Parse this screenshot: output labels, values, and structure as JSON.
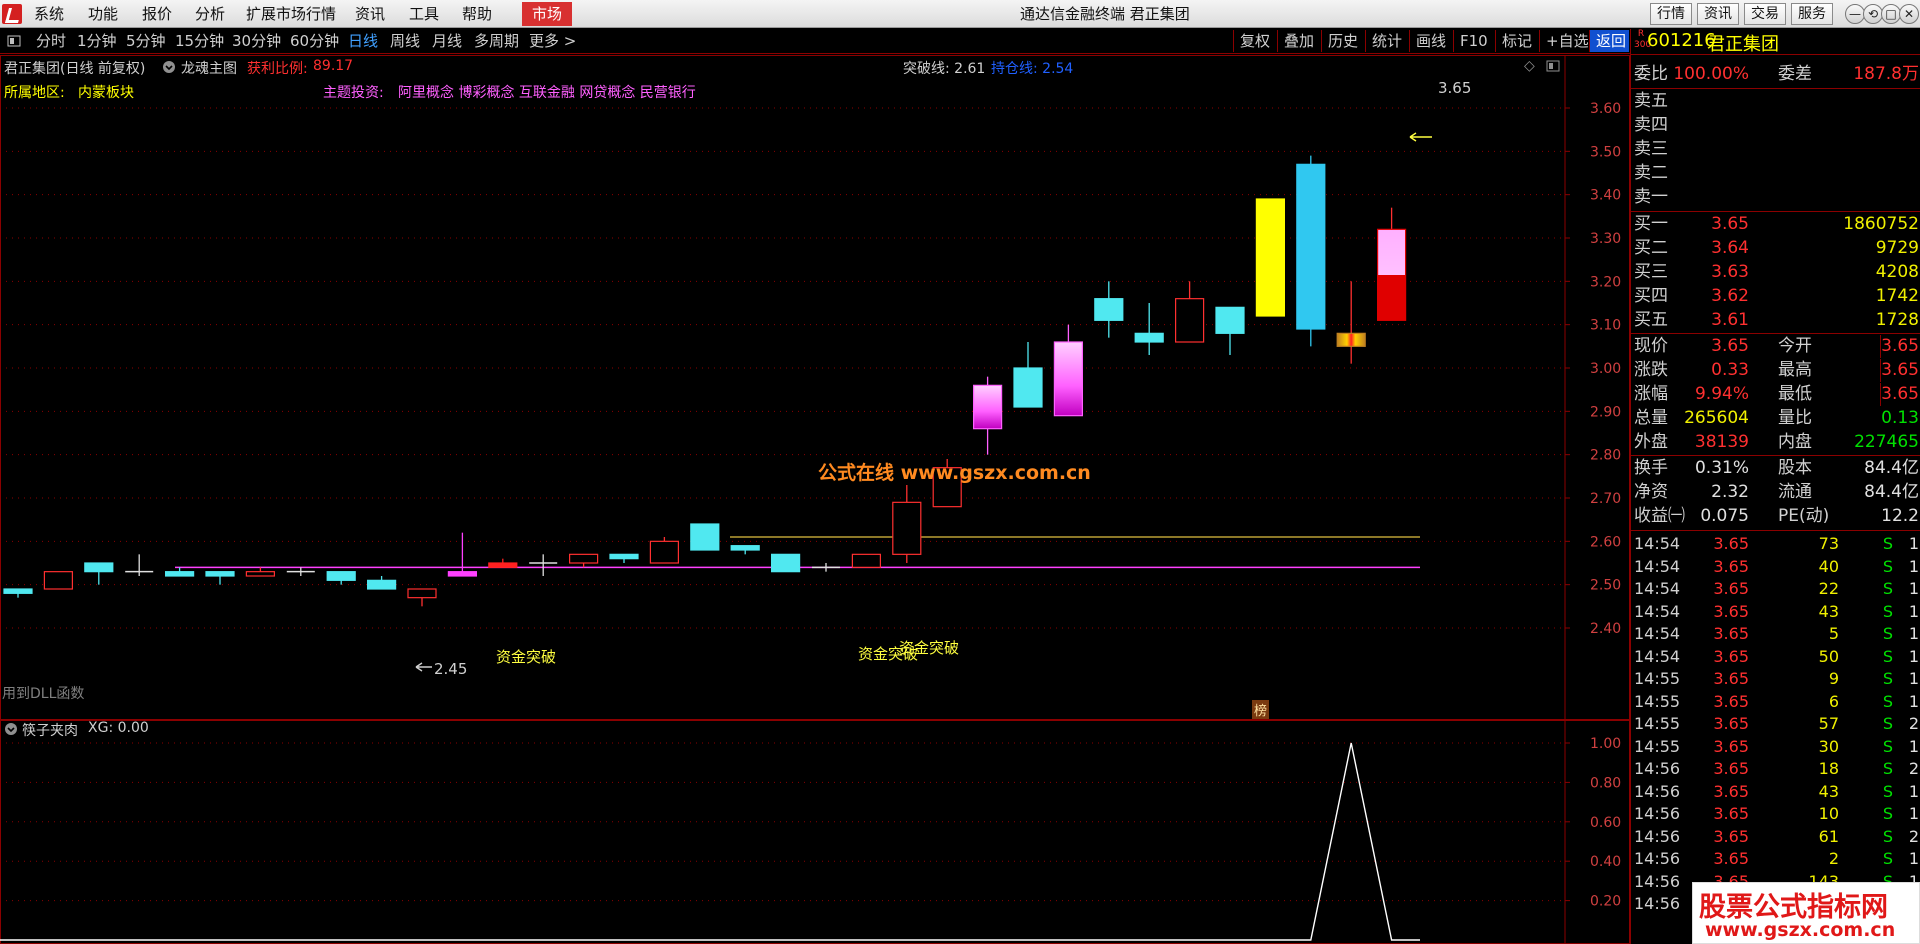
{
  "menubar": {
    "items": [
      "系统",
      "功能",
      "报价",
      "分析",
      "扩展市场行情",
      "资讯",
      "工具",
      "帮助"
    ],
    "market_tab": "市场",
    "app_title": "通达信金融终端  君正集团",
    "right_buttons": [
      "行情",
      "资讯",
      "交易",
      "服务"
    ],
    "window_buttons": [
      "—",
      "⟲",
      "□",
      "✕"
    ]
  },
  "toolbar": {
    "periods": [
      "分时",
      "1分钟",
      "5分钟",
      "15分钟",
      "30分钟",
      "60分钟",
      "日线",
      "周线",
      "月线",
      "多周期",
      "更多 >"
    ],
    "active_period": "日线",
    "right_tools": [
      "复权",
      "叠加",
      "历史",
      "统计",
      "画线",
      "F10",
      "标记",
      "+自选",
      "返回"
    ],
    "active_tool": "返回"
  },
  "main_chart": {
    "header_name": "君正集团(日线 前复权)",
    "indicator_name": "龙魂主图",
    "profit_label": "获利比例:",
    "profit_value": "89.17",
    "breakout_label": "突破线: 2.61",
    "position_label": "持仓线: 2.54",
    "region_label": "所属地区:",
    "region_value": "内蒙板块",
    "theme_label": "主题投资:",
    "theme_value": "阿里概念 博彩概念 互联金融 网贷概念 民营银行",
    "dll_note": "用到DLL函数",
    "watermark_center": "公式在线   www.gszx.com.cn",
    "bang_label": "榜",
    "high_marker": "3.65",
    "low_marker": "2.45",
    "signal_labels": [
      "资金突破",
      "资金突破",
      "资金突破"
    ]
  },
  "chart_data": [
    {
      "type": "candlestick",
      "title": "君正集团(日线 前复权)",
      "ylim": [
        2.34,
        3.66
      ],
      "y_ticks": [
        "3.60",
        "3.50",
        "3.40",
        "3.30",
        "3.20",
        "3.10",
        "3.00",
        "2.90",
        "2.80",
        "2.70",
        "2.60",
        "2.50",
        "2.40"
      ],
      "breakout_line": 2.61,
      "position_line": 2.54,
      "candles": [
        {
          "o": 2.48,
          "c": 2.49,
          "h": 2.49,
          "l": 2.47,
          "color": "#50e8f0",
          "fill": "solid"
        },
        {
          "o": 2.49,
          "c": 2.53,
          "h": 2.53,
          "l": 2.49,
          "color": "#ff3030",
          "fill": "hollow"
        },
        {
          "o": 2.55,
          "c": 2.53,
          "h": 2.55,
          "l": 2.5,
          "color": "#50e8f0",
          "fill": "solid"
        },
        {
          "o": 2.53,
          "c": 2.53,
          "h": 2.57,
          "l": 2.52,
          "color": "#e0e0e0",
          "fill": "doji"
        },
        {
          "o": 2.53,
          "c": 2.52,
          "h": 2.54,
          "l": 2.52,
          "color": "#50e8f0",
          "fill": "solid"
        },
        {
          "o": 2.53,
          "c": 2.52,
          "h": 2.53,
          "l": 2.5,
          "color": "#50e8f0",
          "fill": "solid"
        },
        {
          "o": 2.52,
          "c": 2.53,
          "h": 2.54,
          "l": 2.52,
          "color": "#ff3030",
          "fill": "hollow"
        },
        {
          "o": 2.53,
          "c": 2.53,
          "h": 2.54,
          "l": 2.52,
          "color": "#e0e0e0",
          "fill": "doji"
        },
        {
          "o": 2.53,
          "c": 2.51,
          "h": 2.53,
          "l": 2.5,
          "color": "#50e8f0",
          "fill": "solid"
        },
        {
          "o": 2.51,
          "c": 2.49,
          "h": 2.52,
          "l": 2.49,
          "color": "#50e8f0",
          "fill": "solid"
        },
        {
          "o": 2.47,
          "c": 2.49,
          "h": 2.49,
          "l": 2.45,
          "color": "#ff3030",
          "fill": "hollow"
        },
        {
          "o": 2.53,
          "c": 2.52,
          "h": 2.62,
          "l": 2.52,
          "color": "#ff40ff",
          "fill": "solid"
        },
        {
          "o": 2.54,
          "c": 2.55,
          "h": 2.56,
          "l": 2.54,
          "color": "#ff2020",
          "fill": "solid"
        },
        {
          "o": 2.55,
          "c": 2.55,
          "h": 2.57,
          "l": 2.52,
          "color": "#e0e0e0",
          "fill": "doji"
        },
        {
          "o": 2.55,
          "c": 2.57,
          "h": 2.57,
          "l": 2.54,
          "color": "#ff3030",
          "fill": "hollow"
        },
        {
          "o": 2.57,
          "c": 2.56,
          "h": 2.57,
          "l": 2.55,
          "color": "#50e8f0",
          "fill": "solid"
        },
        {
          "o": 2.55,
          "c": 2.6,
          "h": 2.61,
          "l": 2.55,
          "color": "#ff3030",
          "fill": "hollow"
        },
        {
          "o": 2.64,
          "c": 2.58,
          "h": 2.64,
          "l": 2.58,
          "color": "#50e8f0",
          "fill": "solid"
        },
        {
          "o": 2.59,
          "c": 2.58,
          "h": 2.59,
          "l": 2.57,
          "color": "#50e8f0",
          "fill": "solid"
        },
        {
          "o": 2.57,
          "c": 2.53,
          "h": 2.57,
          "l": 2.53,
          "color": "#50e8f0",
          "fill": "solid"
        },
        {
          "o": 2.54,
          "c": 2.54,
          "h": 2.55,
          "l": 2.53,
          "color": "#e0e0e0",
          "fill": "doji"
        },
        {
          "o": 2.54,
          "c": 2.57,
          "h": 2.57,
          "l": 2.54,
          "color": "#ff3030",
          "fill": "hollow"
        },
        {
          "o": 2.57,
          "c": 2.69,
          "h": 2.73,
          "l": 2.55,
          "color": "#ff3030",
          "fill": "hollow"
        },
        {
          "o": 2.68,
          "c": 2.77,
          "h": 2.79,
          "l": 2.68,
          "color": "#ff3030",
          "fill": "hollow"
        },
        {
          "o": 2.86,
          "c": 2.96,
          "h": 2.98,
          "l": 2.8,
          "color": "#ff60ff",
          "fill": "gradient"
        },
        {
          "o": 3.0,
          "c": 2.91,
          "h": 3.06,
          "l": 2.91,
          "color": "#50e8f0",
          "fill": "solid"
        },
        {
          "o": 2.89,
          "c": 3.06,
          "h": 3.1,
          "l": 2.89,
          "color": "#ff60ff",
          "fill": "gradient"
        },
        {
          "o": 3.16,
          "c": 3.11,
          "h": 3.2,
          "l": 3.07,
          "color": "#50e8f0",
          "fill": "solid"
        },
        {
          "o": 3.08,
          "c": 3.06,
          "h": 3.15,
          "l": 3.03,
          "color": "#50e8f0",
          "fill": "solid"
        },
        {
          "o": 3.06,
          "c": 3.16,
          "h": 3.2,
          "l": 3.06,
          "color": "#ff3030",
          "fill": "hollow"
        },
        {
          "o": 3.14,
          "c": 3.08,
          "h": 3.14,
          "l": 3.03,
          "color": "#50e8f0",
          "fill": "solid"
        },
        {
          "o": 3.12,
          "c": 3.39,
          "h": 3.39,
          "l": 3.12,
          "color": "#ffff00",
          "fill": "solid"
        },
        {
          "o": 3.47,
          "c": 3.09,
          "h": 3.49,
          "l": 3.05,
          "color": "#30c8f0",
          "fill": "solid"
        },
        {
          "o": 3.08,
          "c": 3.05,
          "h": 3.2,
          "l": 3.01,
          "color": "#e0c020",
          "fill": "mixed"
        },
        {
          "o": 3.11,
          "c": 3.32,
          "h": 3.37,
          "l": 3.11,
          "color": "#ff2020",
          "fill": "gradient2"
        }
      ]
    },
    {
      "type": "line",
      "title": "筷子夹肉",
      "series": [
        {
          "name": "XG",
          "values": [
            0,
            0,
            0,
            0,
            0,
            0,
            0,
            0,
            0,
            0,
            0,
            0,
            0,
            0,
            0,
            0,
            0,
            0,
            0,
            0,
            0,
            0,
            0,
            0,
            0,
            0,
            0,
            0,
            0,
            0,
            0,
            0,
            0,
            1,
            0
          ]
        }
      ],
      "ylim": [
        0,
        1
      ],
      "y_ticks": [
        "1.00",
        "0.80",
        "0.60",
        "0.40",
        "0.20"
      ]
    }
  ],
  "sub_chart": {
    "indicator_name": "筷子夹肉",
    "xg_label": "XG: 0.00"
  },
  "quote": {
    "market_badge_top": "R",
    "market_badge_bottom": "300",
    "code": "601216",
    "name": "君正集团",
    "weibi_label": "委比",
    "weibi_value": "100.00%",
    "weicha_label": "委差",
    "weicha_value": "187.8万",
    "sells": [
      {
        "label": "卖五"
      },
      {
        "label": "卖四"
      },
      {
        "label": "卖三"
      },
      {
        "label": "卖二"
      },
      {
        "label": "卖一"
      }
    ],
    "buys": [
      {
        "label": "买一",
        "price": "3.65",
        "vol": "1860752"
      },
      {
        "label": "买二",
        "price": "3.64",
        "vol": "9729"
      },
      {
        "label": "买三",
        "price": "3.63",
        "vol": "4208"
      },
      {
        "label": "买四",
        "price": "3.62",
        "vol": "1742"
      },
      {
        "label": "买五",
        "price": "3.61",
        "vol": "1728"
      }
    ],
    "stats1": [
      {
        "l1": "现价",
        "v1": "3.65",
        "c1": "red",
        "l2": "今开",
        "v2": "3.65",
        "c2": "red"
      },
      {
        "l1": "涨跌",
        "v1": "0.33",
        "c1": "red",
        "l2": "最高",
        "v2": "3.65",
        "c2": "red"
      },
      {
        "l1": "涨幅",
        "v1": "9.94%",
        "c1": "red",
        "l2": "最低",
        "v2": "3.65",
        "c2": "red"
      },
      {
        "l1": "总量",
        "v1": "265604",
        "c1": "yellow",
        "l2": "量比",
        "v2": "0.13",
        "c2": "green"
      },
      {
        "l1": "外盘",
        "v1": "38139",
        "c1": "red",
        "l2": "内盘",
        "v2": "227465",
        "c2": "green"
      }
    ],
    "stats2": [
      {
        "l1": "换手",
        "v1": "0.31%",
        "l2": "股本",
        "v2": "84.4亿"
      },
      {
        "l1": "净资",
        "v1": "2.32",
        "l2": "流通",
        "v2": "84.4亿"
      },
      {
        "l1": "收益㈠",
        "v1": "0.075",
        "l2": "PE(动)",
        "v2": "12.2"
      }
    ],
    "ticks": [
      {
        "t": "14:54",
        "p": "3.65",
        "v": "73",
        "s": "S",
        "n": "1"
      },
      {
        "t": "14:54",
        "p": "3.65",
        "v": "40",
        "s": "S",
        "n": "1"
      },
      {
        "t": "14:54",
        "p": "3.65",
        "v": "22",
        "s": "S",
        "n": "1"
      },
      {
        "t": "14:54",
        "p": "3.65",
        "v": "43",
        "s": "S",
        "n": "1"
      },
      {
        "t": "14:54",
        "p": "3.65",
        "v": "5",
        "s": "S",
        "n": "1"
      },
      {
        "t": "14:54",
        "p": "3.65",
        "v": "50",
        "s": "S",
        "n": "1"
      },
      {
        "t": "14:55",
        "p": "3.65",
        "v": "9",
        "s": "S",
        "n": "1"
      },
      {
        "t": "14:55",
        "p": "3.65",
        "v": "6",
        "s": "S",
        "n": "1"
      },
      {
        "t": "14:55",
        "p": "3.65",
        "v": "57",
        "s": "S",
        "n": "2"
      },
      {
        "t": "14:55",
        "p": "3.65",
        "v": "30",
        "s": "S",
        "n": "1"
      },
      {
        "t": "14:56",
        "p": "3.65",
        "v": "18",
        "s": "S",
        "n": "2"
      },
      {
        "t": "14:56",
        "p": "3.65",
        "v": "43",
        "s": "S",
        "n": "1"
      },
      {
        "t": "14:56",
        "p": "3.65",
        "v": "10",
        "s": "S",
        "n": "1"
      },
      {
        "t": "14:56",
        "p": "3.65",
        "v": "61",
        "s": "S",
        "n": "2"
      },
      {
        "t": "14:56",
        "p": "3.65",
        "v": "2",
        "s": "S",
        "n": "1"
      },
      {
        "t": "14:56",
        "p": "3.65",
        "v": "143",
        "s": "S",
        "n": "1"
      },
      {
        "t": "14:56",
        "p": "",
        "v": "",
        "s": "",
        "n": ""
      }
    ]
  },
  "watermark": {
    "line1": "股票公式指标网",
    "line2": "www.gszx.com.cn"
  }
}
